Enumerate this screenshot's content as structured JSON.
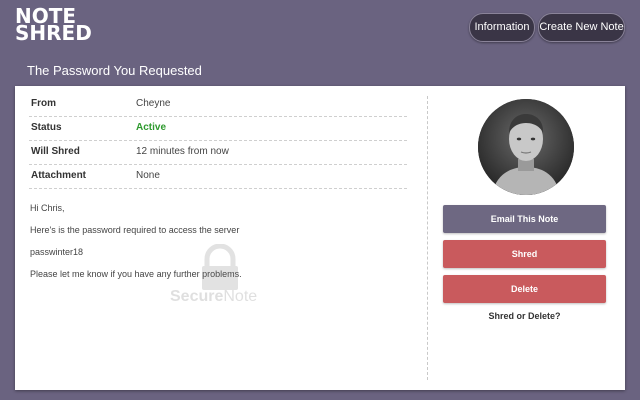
{
  "header": {
    "logo_line1": "NOTE",
    "logo_line2": "SHRED",
    "nav": [
      {
        "label": "Information"
      },
      {
        "label": "Create New Note"
      }
    ]
  },
  "panel": {
    "title": "The Password You Requested",
    "rows": [
      {
        "label": "From",
        "value": "Cheyne"
      },
      {
        "label": "Status",
        "value": "Active"
      },
      {
        "label": "Will Shred",
        "value": "12 minutes from now"
      },
      {
        "label": "Attachment",
        "value": "None"
      }
    ],
    "message": [
      "Hi Chris,",
      "Here's is the password required to access the server",
      "passwinter18",
      "Please let me know if you have any further problems."
    ],
    "watermark": {
      "part1": "Secure",
      "part2": "Note"
    }
  },
  "sidebar": {
    "email_label": "Email This Note",
    "shred_label": "Shred",
    "delete_label": "Delete",
    "note": "Shred or Delete?"
  },
  "colors": {
    "background": "#6a6380",
    "active": "#2e9a2e",
    "danger": "#c95a5d",
    "primary": "#6e6882"
  }
}
